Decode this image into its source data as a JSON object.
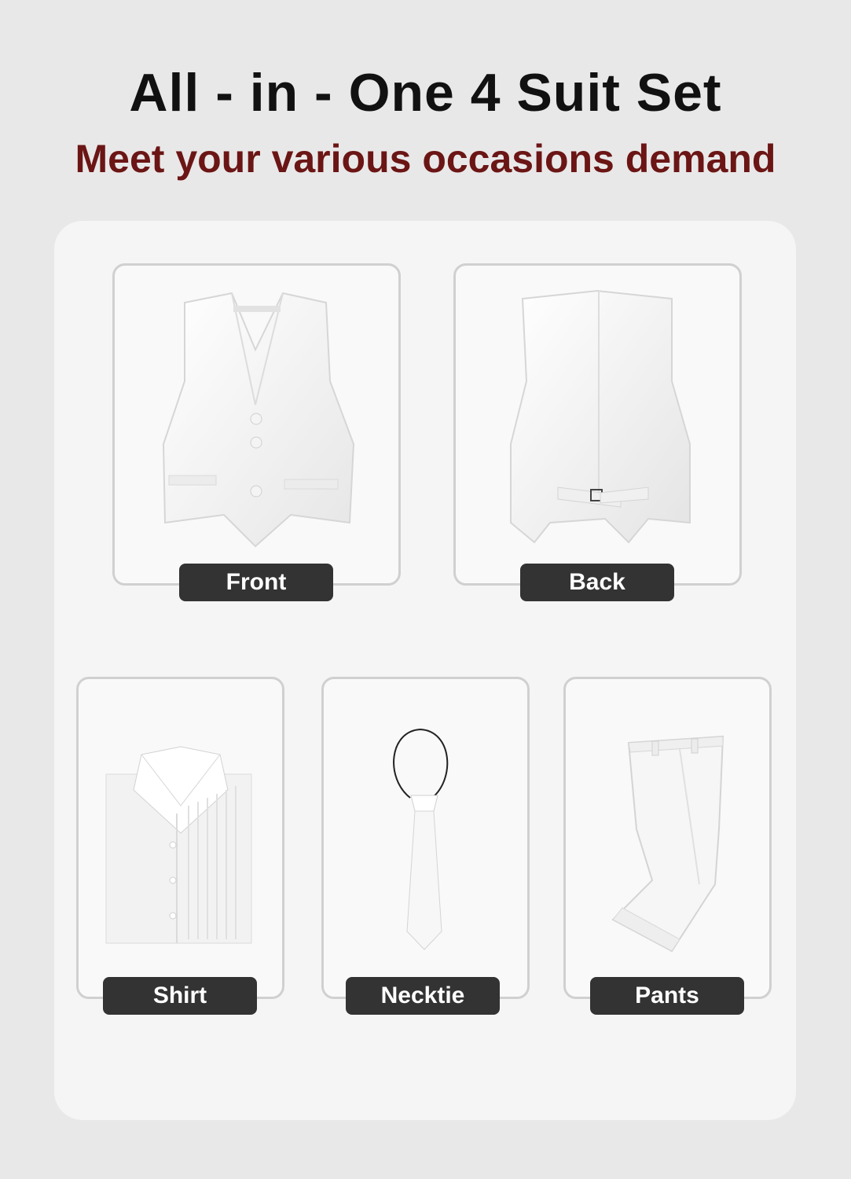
{
  "header": {
    "title": "All - in - One 4 Suit Set",
    "subtitle": "Meet your various occasions demand"
  },
  "items": [
    {
      "label": "Front",
      "image": "vest-front-icon"
    },
    {
      "label": "Back",
      "image": "vest-back-icon"
    },
    {
      "label": "Shirt",
      "image": "shirt-icon"
    },
    {
      "label": "Necktie",
      "image": "necktie-icon"
    },
    {
      "label": "Pants",
      "image": "pants-icon"
    }
  ],
  "colors": {
    "background": "#e9e8e8",
    "panel": "#f5f5f5",
    "title": "#111111",
    "subtitle": "#6b1515",
    "label_bg": "#333333",
    "label_text": "#ffffff"
  }
}
